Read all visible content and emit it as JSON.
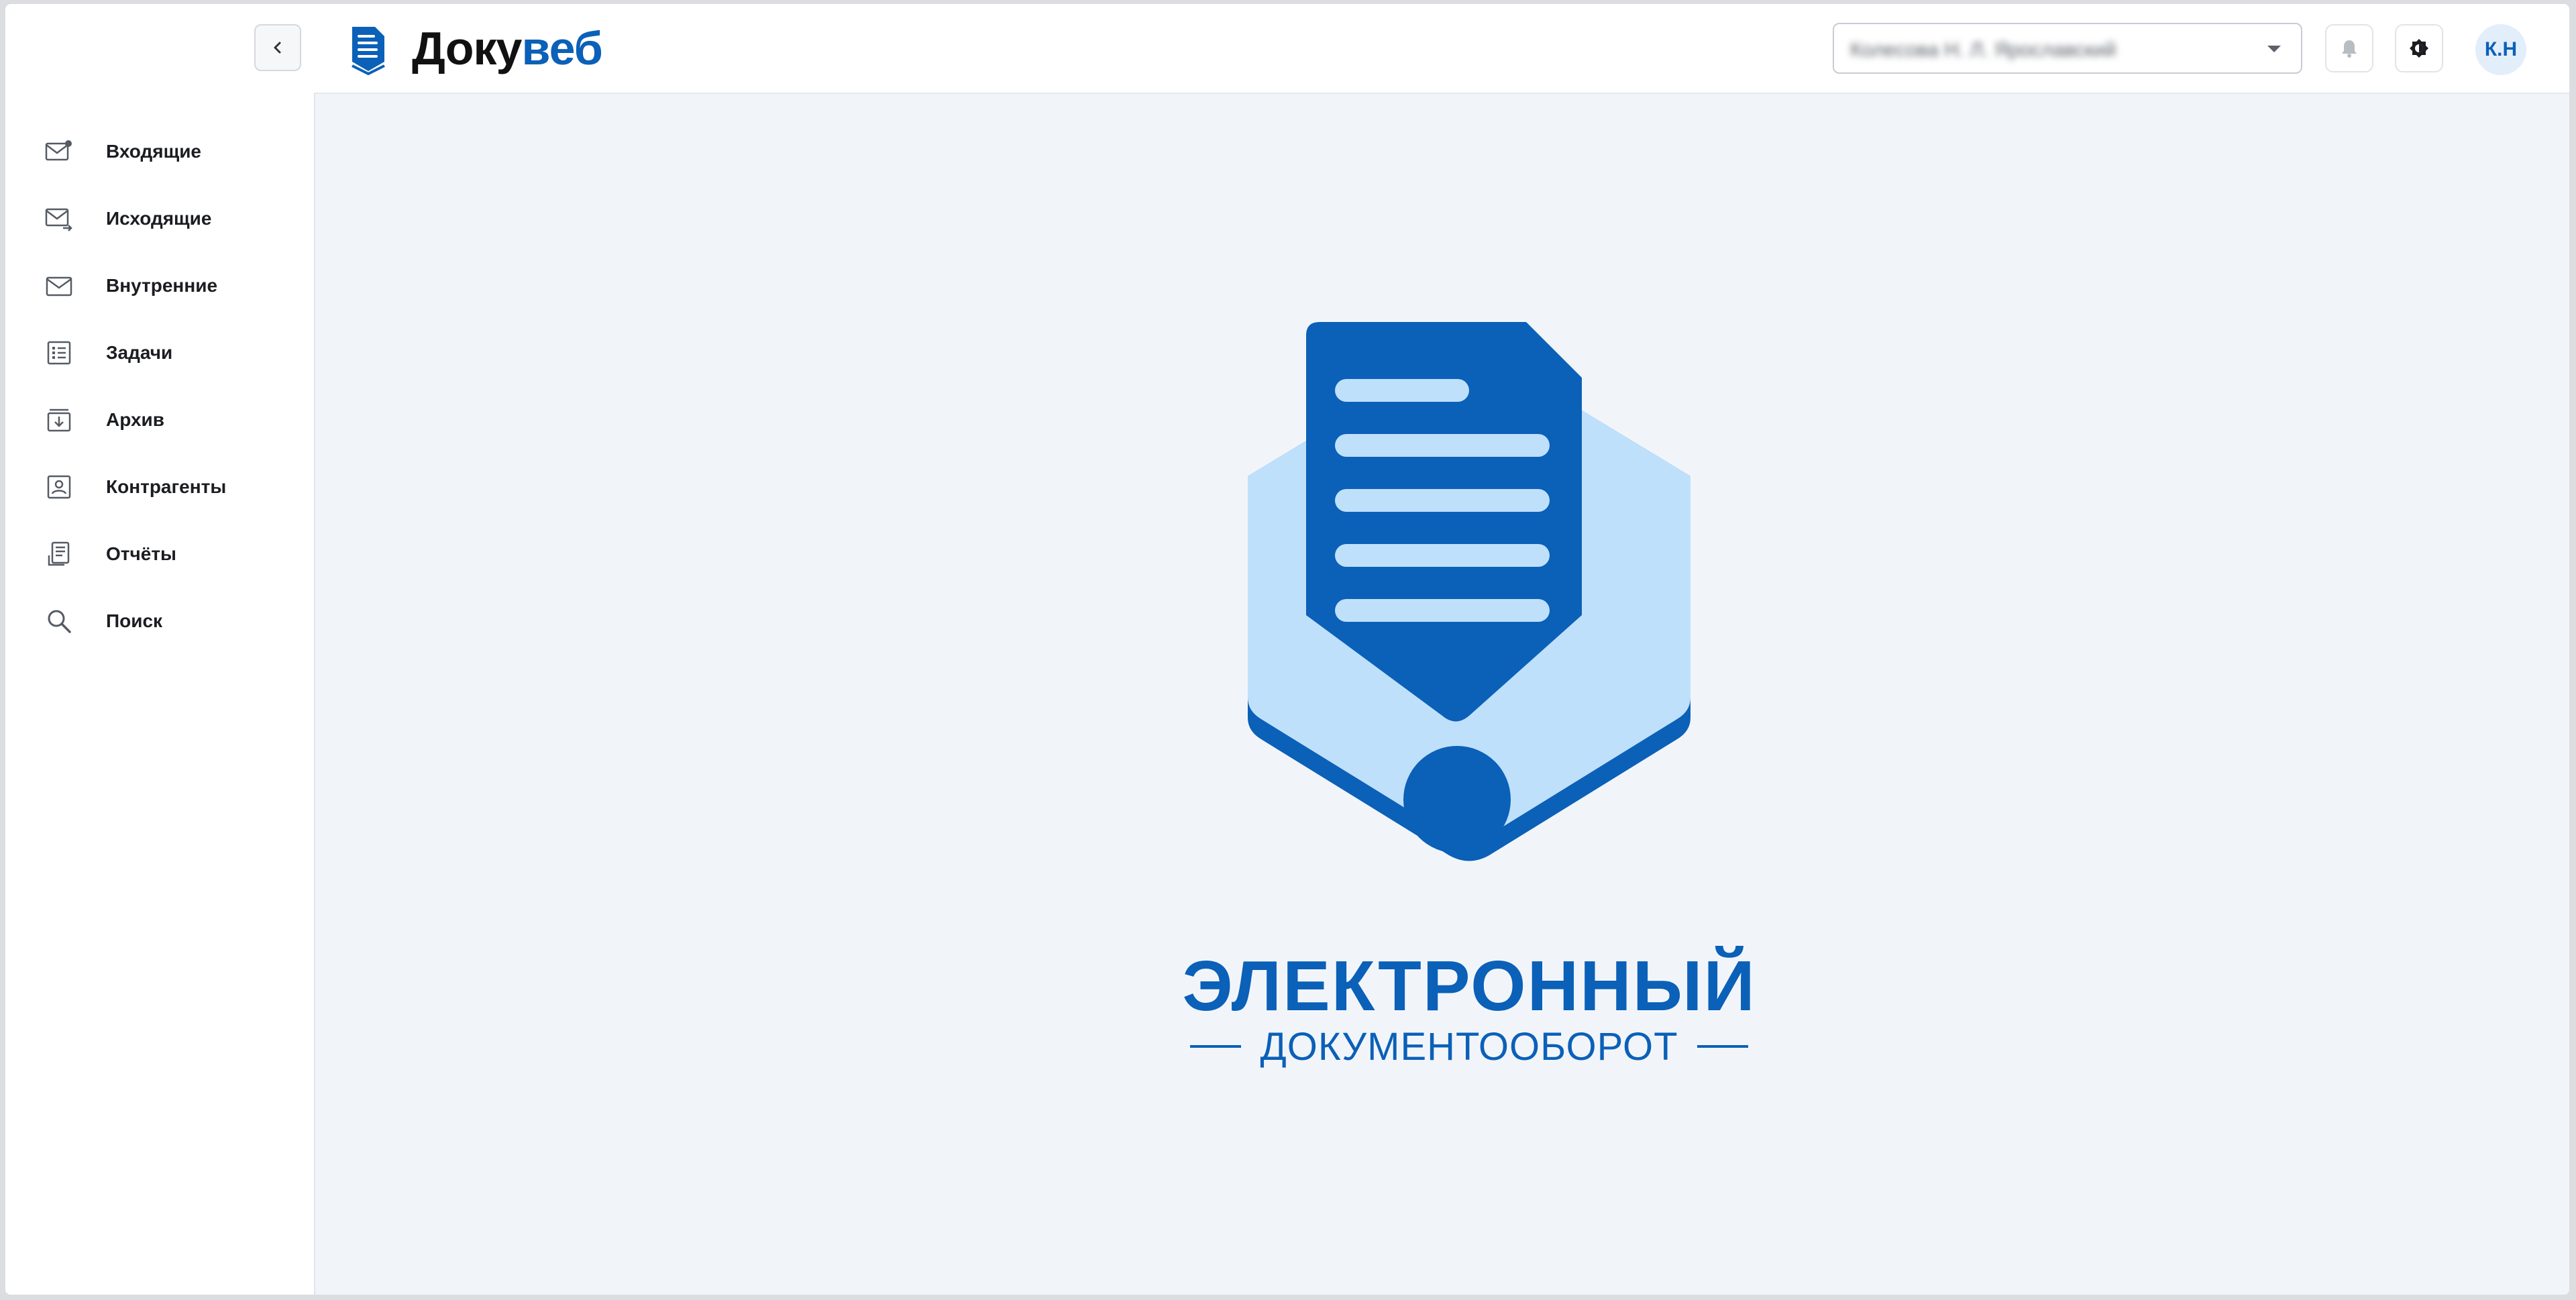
{
  "header": {
    "brand_part1": "Доку",
    "brand_part2": "веб",
    "org_select_value": "Колесова Н. Л. Ярославский",
    "avatar_initials": "К.Н"
  },
  "sidebar": {
    "items": [
      {
        "label": "Входящие",
        "icon": "inbox-icon"
      },
      {
        "label": "Исходящие",
        "icon": "outbox-icon"
      },
      {
        "label": "Внутренние",
        "icon": "mail-icon"
      },
      {
        "label": "Задачи",
        "icon": "task-list-icon"
      },
      {
        "label": "Архив",
        "icon": "archive-icon"
      },
      {
        "label": "Контрагенты",
        "icon": "contact-card-icon"
      },
      {
        "label": "Отчёты",
        "icon": "report-icon"
      },
      {
        "label": "Поиск",
        "icon": "search-icon"
      }
    ]
  },
  "main": {
    "hero_title": "ЭЛЕКТРОННЫЙ",
    "hero_subtitle": "ДОКУМЕНТООБОРОТ"
  },
  "colors": {
    "brand_blue": "#0b60b8",
    "light_blue": "#bfe0fb",
    "background": "#f1f5fa"
  }
}
